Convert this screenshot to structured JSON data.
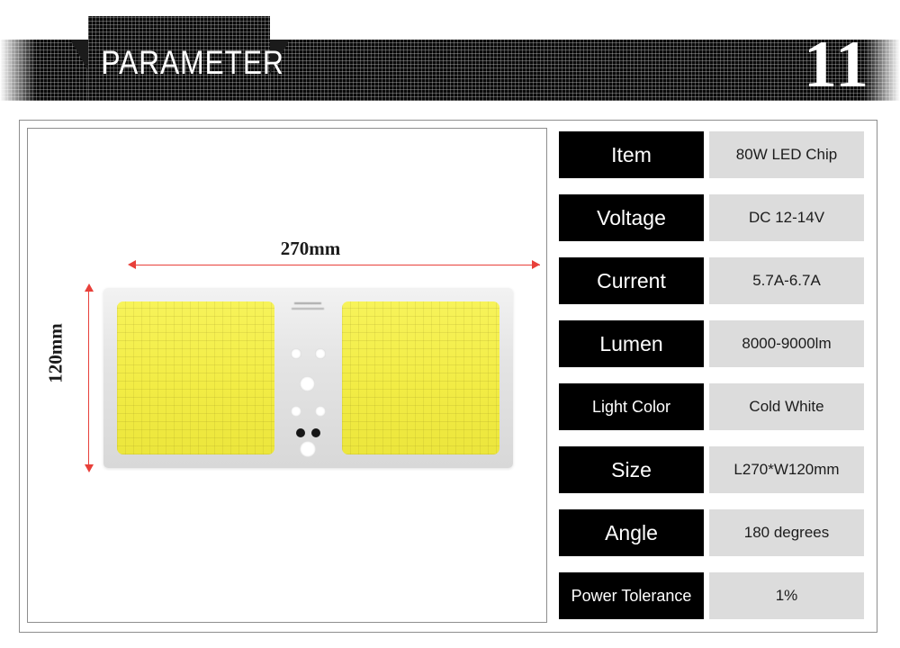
{
  "header": {
    "title": "PARAMETER",
    "page_number": "11",
    "background_color": "#0b0b0b",
    "text_color": "#ffffff"
  },
  "product_image": {
    "dimension_width_label": "270mm",
    "dimension_height_label": "120mm",
    "dimension_line_color": "#e8403a",
    "panel_body_color": "#e3e3e3",
    "emitter_color": "#f2ec45"
  },
  "spec_table": {
    "rows": [
      {
        "label": "Item",
        "value": "80W LED Chip"
      },
      {
        "label": "Voltage",
        "value": "DC 12-14V"
      },
      {
        "label": "Current",
        "value": "5.7A-6.7A"
      },
      {
        "label": "Lumen",
        "value": "8000-9000lm"
      },
      {
        "label": "Light Color",
        "value": "Cold White"
      },
      {
        "label": "Size",
        "value": "L270*W120mm"
      },
      {
        "label": "Angle",
        "value": "180 degrees"
      },
      {
        "label": "Power Tolerance",
        "value": "1%"
      }
    ],
    "label_background": "#000000",
    "label_color": "#ffffff",
    "value_background": "#dcdcdc",
    "value_color": "#1c1c1c"
  }
}
